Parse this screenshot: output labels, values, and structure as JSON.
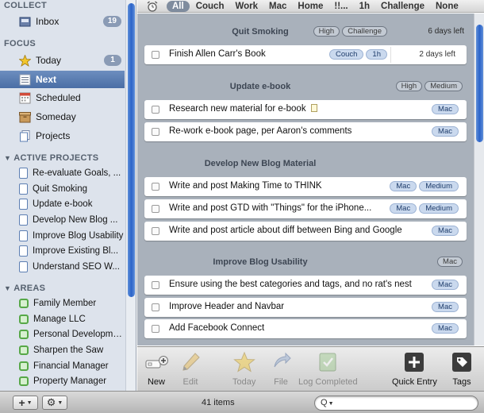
{
  "sidebar": {
    "collect_header": "COLLECT",
    "inbox": {
      "label": "Inbox",
      "count": "19"
    },
    "focus_header": "FOCUS",
    "today": {
      "label": "Today",
      "count": "1"
    },
    "next": {
      "label": "Next"
    },
    "scheduled": {
      "label": "Scheduled"
    },
    "someday": {
      "label": "Someday"
    },
    "projects": {
      "label": "Projects"
    },
    "active_projects_header": "ACTIVE PROJECTS",
    "active_projects": [
      "Re-evaluate Goals, ...",
      "Quit Smoking",
      "Update e-book",
      "Develop New Blog ...",
      "Improve Blog Usability",
      "Improve Existing Bl...",
      "Understand SEO W..."
    ],
    "areas_header": "AREAS",
    "areas": [
      "Family Member",
      "Manage LLC",
      "Personal Development",
      "Sharpen the Saw",
      "Financial Manager",
      "Property Manager"
    ]
  },
  "filterbar": {
    "tags": [
      "All",
      "Couch",
      "Work",
      "Mac",
      "Home",
      "!!...",
      "1h",
      "Challenge",
      "None"
    ],
    "active": "All"
  },
  "groups": [
    {
      "title": "Quit Smoking",
      "tags": [
        "High",
        "Challenge"
      ],
      "due": "6 days left",
      "tasks": [
        {
          "text": "Finish Allen Carr's Book",
          "tags": [
            "Couch",
            "1h"
          ],
          "due": "2 days left"
        }
      ]
    },
    {
      "title": "Update e-book",
      "tags": [
        "High",
        "Medium"
      ],
      "tasks": [
        {
          "text": "Research new material for e-book",
          "tags": [
            "Mac"
          ],
          "note": true
        },
        {
          "text": "Re-work e-book page, per Aaron's comments",
          "tags": [
            "Mac"
          ]
        }
      ]
    },
    {
      "title": "Develop New Blog Material",
      "tags": [],
      "tasks": [
        {
          "text": "Write and post Making Time to THINK",
          "tags": [
            "Mac",
            "Medium"
          ]
        },
        {
          "text": "Write and post GTD with \"Things\" for the iPhone...",
          "tags": [
            "Mac",
            "Medium"
          ]
        },
        {
          "text": "Write and post article about diff between Bing and Google",
          "tags": [
            "Mac"
          ]
        }
      ]
    },
    {
      "title": "Improve Blog Usability",
      "tags": [
        "Mac"
      ],
      "tasks": [
        {
          "text": "Ensure using the best categories and tags, and no rat's nest",
          "tags": [
            "Mac"
          ]
        },
        {
          "text": "Improve Header and Navbar",
          "tags": [
            "Mac"
          ]
        },
        {
          "text": "Add Facebook Connect",
          "tags": [
            "Mac"
          ]
        }
      ]
    }
  ],
  "toolbar": {
    "new": "New",
    "edit": "Edit",
    "today": "Today",
    "file": "File",
    "log_completed": "Log Completed",
    "quick_entry": "Quick Entry",
    "tags": "Tags"
  },
  "statusbar": {
    "add_button": "+",
    "gear_button": "⚙",
    "items_count": "41 items",
    "search_icon": "Q",
    "search_value": ""
  },
  "colors": {
    "sidebar_bg": "#dde3ec",
    "selection": "#4a6ea5",
    "list_bg": "#a9b1bb",
    "tag_bg": "#cad9ee"
  }
}
